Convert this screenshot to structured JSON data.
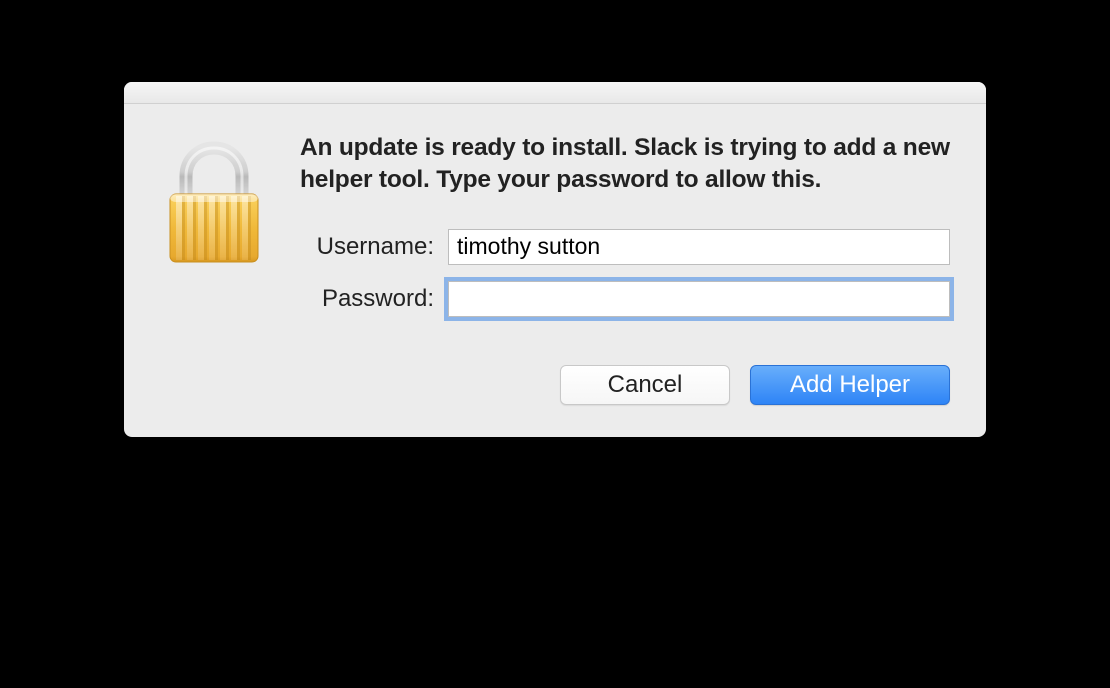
{
  "dialog": {
    "message": "An update is ready to install. Slack is trying to add a new helper tool. Type your password to allow this.",
    "username_label": "Username:",
    "password_label": "Password:",
    "username_value": "timothy sutton",
    "password_value": "",
    "cancel_label": "Cancel",
    "confirm_label": "Add Helper",
    "icon": "lock-icon"
  }
}
